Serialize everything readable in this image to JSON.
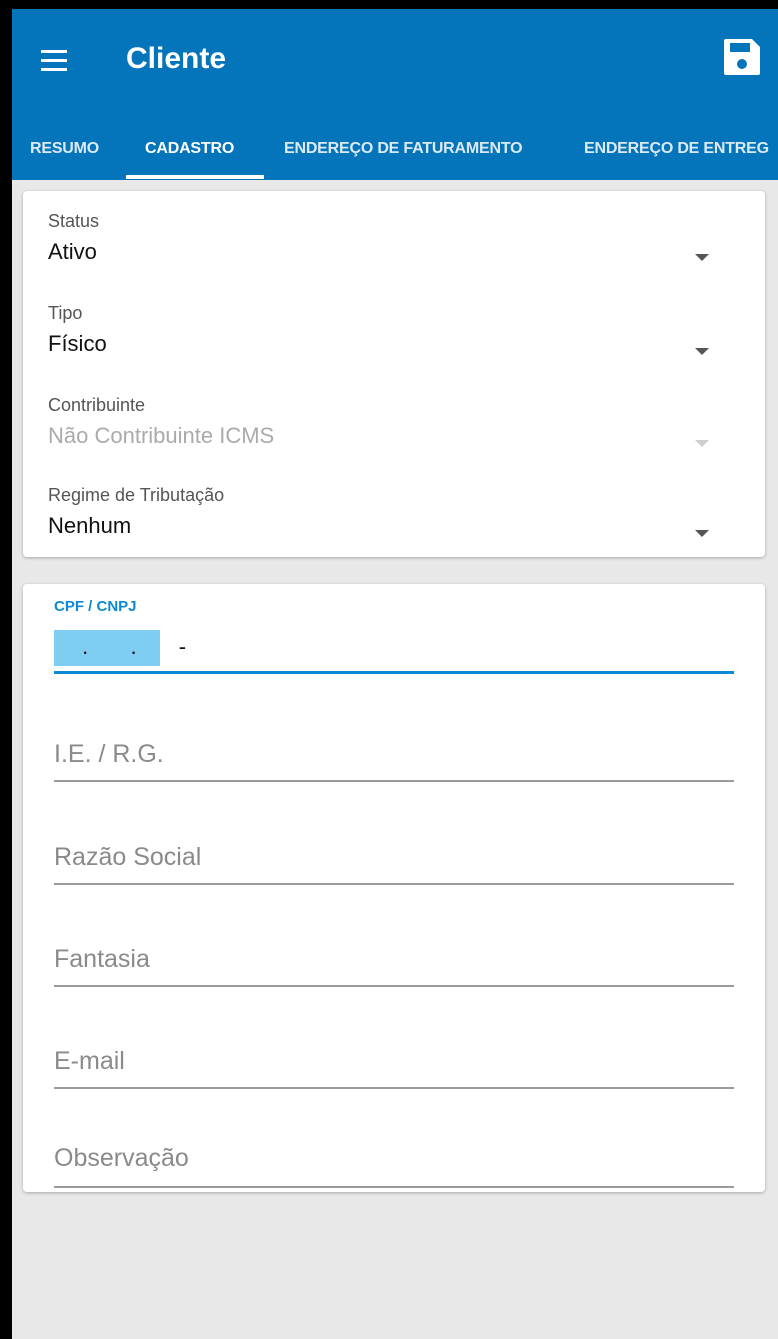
{
  "appbar": {
    "title": "Cliente",
    "menu_icon": "menu-icon",
    "save_icon": "save-icon",
    "background": "#0575bb"
  },
  "tabs": [
    {
      "label": "RESUMO",
      "active": false
    },
    {
      "label": "CADASTRO",
      "active": true
    },
    {
      "label": "ENDEREÇO DE FATURAMENTO",
      "active": false
    },
    {
      "label": "ENDEREÇO DE ENTREG",
      "active": false
    }
  ],
  "selects": [
    {
      "label": "Status",
      "value": "Ativo",
      "disabled": false
    },
    {
      "label": "Tipo",
      "value": "Físico",
      "disabled": false
    },
    {
      "label": "Contribuinte",
      "value": "Não Contribuinte ICMS",
      "disabled": true
    },
    {
      "label": "Regime de Tributação",
      "value": "Nenhum",
      "disabled": false
    }
  ],
  "cpf_field": {
    "label": "CPF / CNPJ",
    "value": " .  .  -",
    "accent": "#0a8ad6"
  },
  "fields": [
    {
      "placeholder": "I.E. / R.G."
    },
    {
      "placeholder": "Razão Social"
    },
    {
      "placeholder": "Fantasia"
    },
    {
      "placeholder": "E-mail"
    },
    {
      "placeholder": "Observação"
    }
  ]
}
